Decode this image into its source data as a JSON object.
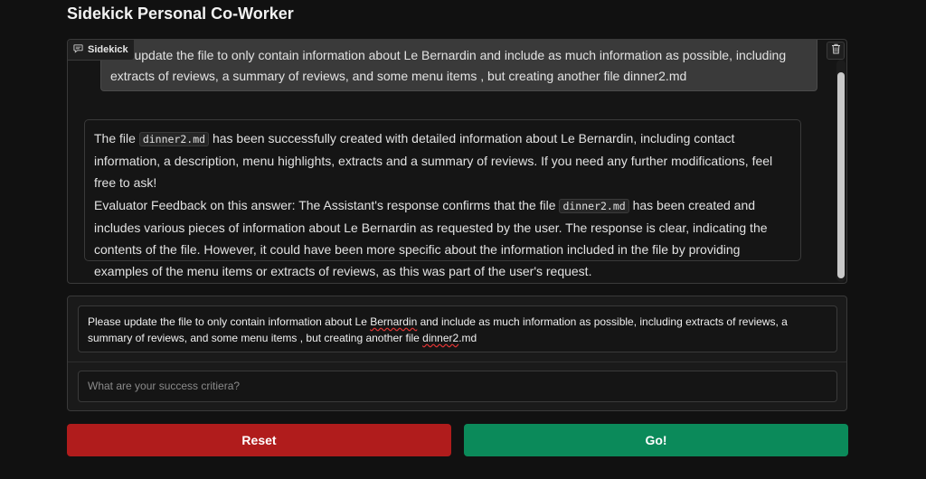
{
  "app": {
    "title": "Sidekick Personal Co-Worker"
  },
  "chat": {
    "label": "Sidekick",
    "icons": {
      "label_icon": "chat-bubble-icon",
      "clear_icon": "trash-icon"
    },
    "user_message_visible": "ase update the file to only contain information about Le Bernardin and include as much information as possible, including extracts of reviews, a summary of reviews, and some menu items , but creating another file dinner2.md",
    "assistant": {
      "p1_before": "The file ",
      "p1_code": "dinner2.md",
      "p1_after": " has been successfully created with detailed information about Le Bernardin, including contact information, a description, menu highlights, extracts and a summary of reviews. If you need any further modifications, feel free to ask!",
      "p2_before": "Evaluator Feedback on this answer: The Assistant's response confirms that the file ",
      "p2_code": "dinner2.md",
      "p2_after": " has been created and includes various pieces of information about Le Bernardin as requested by the user. The response is clear, indicating the contents of the file. However, it could have been more specific about the information included in the file by providing examples of the menu items or extracts of reviews, as this was part of the user's request."
    }
  },
  "input": {
    "message_before": "Please update the file to only contain information about Le ",
    "message_misspelled": "Bernardin",
    "message_middle": " and include as much information as possible, including extracts of reviews, a summary of reviews, and some menu items , but creating another file ",
    "message_misspelled2": "dinner2",
    "message_after": ".md",
    "criteria_placeholder": "What are your success critiera?"
  },
  "buttons": {
    "reset": "Reset",
    "go": "Go!"
  },
  "colors": {
    "reset": "#b01c1c",
    "go": "#0b8a5a",
    "background": "#111111"
  }
}
